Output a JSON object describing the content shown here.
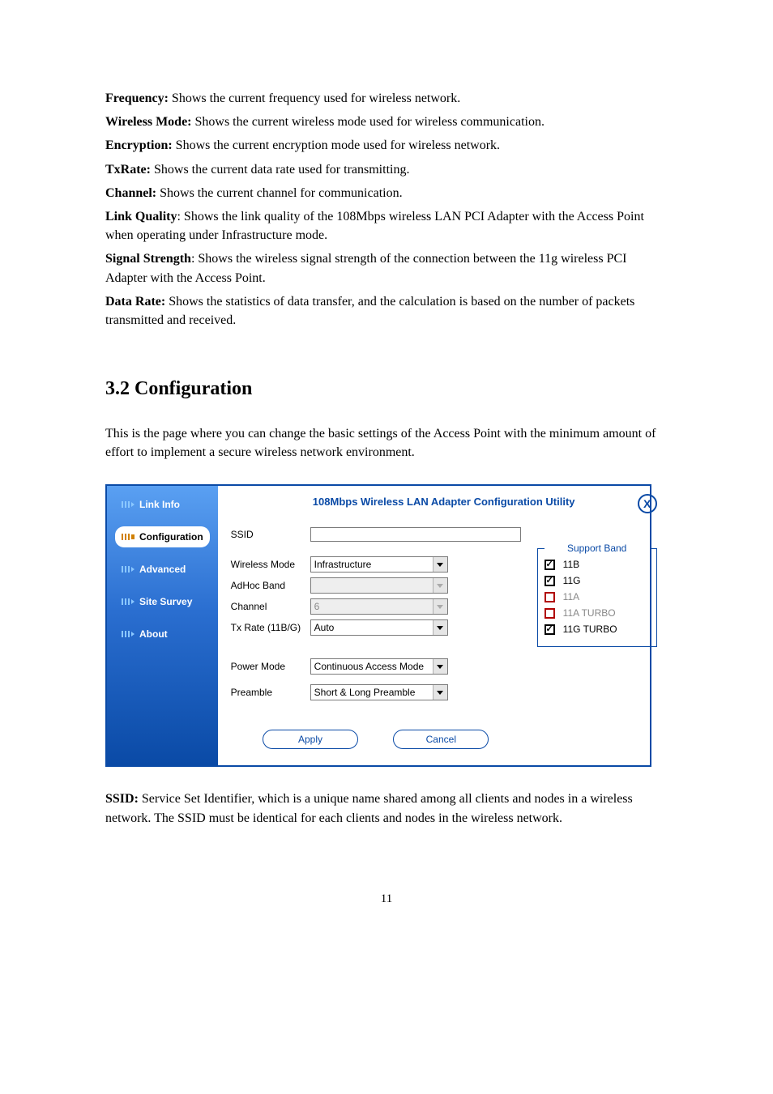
{
  "definitions": [
    {
      "term": "Frequency:",
      "desc": " Shows the current frequency used for wireless network."
    },
    {
      "term": "Wireless Mode:",
      "desc": " Shows the current wireless mode used for wireless communication."
    },
    {
      "term": "Encryption:",
      "desc": " Shows the current encryption mode used for wireless network."
    },
    {
      "term": "TxRate:",
      "desc": " Shows the current data rate used for transmitting."
    },
    {
      "term": "Channel:",
      "desc": " Shows the current channel for communication."
    },
    {
      "term": "Link Quality",
      "desc": ": Shows the link quality of the 108Mbps wireless LAN PCI Adapter  with the Access Point when operating under Infrastructure mode."
    },
    {
      "term": "Signal Strength",
      "desc": ": Shows the wireless signal strength of the connection between the 11g wireless PCI Adapter with the Access Point."
    },
    {
      "term": "Data Rate:",
      "desc": " Shows the statistics of data transfer, and the calculation is based on the number of packets transmitted and received."
    }
  ],
  "section_heading": "3.2 Configuration",
  "intro": "This is the page where you can change the basic settings of the Access Point with the minimum amount of effort to implement a secure wireless network environment.",
  "utility": {
    "nav": {
      "link_info": "Link Info",
      "configuration": "Configuration",
      "advanced": "Advanced",
      "site_survey": "Site Survey",
      "about": "About"
    },
    "title": "108Mbps Wireless LAN Adapter Configuration Utility",
    "close": "X",
    "labels": {
      "ssid": "SSID",
      "wireless_mode": "Wireless Mode",
      "adhoc_band": "AdHoc Band",
      "channel": "Channel",
      "tx_rate": "Tx Rate (11B/G)",
      "power_mode": "Power Mode",
      "preamble": "Preamble"
    },
    "values": {
      "ssid": "",
      "wireless_mode": "Infrastructure",
      "adhoc_band": "",
      "channel": "6",
      "tx_rate": "Auto",
      "power_mode": "Continuous Access Mode",
      "preamble": "Short & Long Preamble"
    },
    "support_band": {
      "legend": "Support Band",
      "items": [
        {
          "label": "11B",
          "checked": true,
          "enabled": true
        },
        {
          "label": "11G",
          "checked": true,
          "enabled": true
        },
        {
          "label": "11A",
          "checked": false,
          "enabled": false
        },
        {
          "label": "11A TURBO",
          "checked": false,
          "enabled": false
        },
        {
          "label": "11G TURBO",
          "checked": true,
          "enabled": true
        }
      ]
    },
    "buttons": {
      "apply": "Apply",
      "cancel": "Cancel"
    }
  },
  "after": {
    "term": "SSID:",
    "desc": " Service Set Identifier, which is a unique name shared among all clients and nodes in a wireless network. The SSID must be identical for each clients and nodes in the wireless network."
  },
  "page_number": "11"
}
